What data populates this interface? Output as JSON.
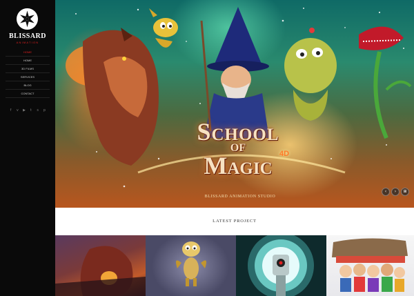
{
  "brand": {
    "name": "BLISSARD",
    "tagline": "ANIMATION",
    "logo_icon": "star-snowflake-icon"
  },
  "nav": {
    "items": [
      {
        "label": "HOME",
        "active": true
      },
      {
        "label": "HOME",
        "active": false
      },
      {
        "label": "3D FILMS",
        "active": false
      },
      {
        "label": "SERVICES",
        "active": false
      },
      {
        "label": "BLOG",
        "active": false
      },
      {
        "label": "CONTACT",
        "active": false
      }
    ]
  },
  "social": {
    "items": [
      {
        "icon": "facebook-icon",
        "glyph": "f"
      },
      {
        "icon": "vimeo-icon",
        "glyph": "v"
      },
      {
        "icon": "youtube-icon",
        "glyph": "▶"
      },
      {
        "icon": "twitter-icon",
        "glyph": "t"
      },
      {
        "icon": "skype-icon",
        "glyph": "s"
      },
      {
        "icon": "pinterest-icon",
        "glyph": "p"
      }
    ]
  },
  "hero": {
    "title_line1": "School",
    "title_line2": "OF",
    "title_badge": "4D",
    "title_line3": "Magic",
    "studio": "BLISSARD ANIMATION STUDIO",
    "controls": {
      "prev": "‹",
      "next": "›",
      "grid": "⊞"
    }
  },
  "latest": {
    "title": "LATEST PROJECT"
  },
  "colors": {
    "accent": "#e02020",
    "sidebar": "#0a0a0a"
  }
}
